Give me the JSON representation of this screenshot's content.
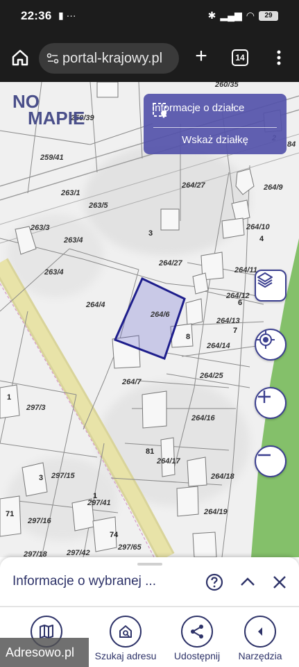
{
  "status_bar": {
    "time": "22:36",
    "left_icons": "▮ ···",
    "battery": "29"
  },
  "browser": {
    "url": "portal-krajowy.pl",
    "tab_count": "14"
  },
  "map": {
    "logo_line1": "NO",
    "logo_line2": "MAPIE",
    "info_panel": {
      "title": "Informacje o działce",
      "show_parcel": "Wskaż działkę"
    },
    "parcel_labels": [
      "260/35",
      "259/39",
      "259/41",
      "264/27",
      "264/9",
      "263/1",
      "263/5",
      "264/10",
      "263/3",
      "263/4",
      "264/27",
      "264/11",
      "263/4",
      "264/4",
      "264/12",
      "264/6",
      "264/13",
      "264/14",
      "264/25",
      "264/7",
      "297/3",
      "264/16",
      "264/17",
      "264/18",
      "297/15",
      "297/41",
      "297/16",
      "264/19",
      "297/65",
      "297/42",
      "297/18",
      "2",
      "84"
    ],
    "house_numbers": [
      "3",
      "4",
      "6",
      "7",
      "8",
      "1",
      "81",
      "3",
      "1",
      "71",
      "74"
    ],
    "selected_parcel": "264/6"
  },
  "sheet": {
    "title": "Informacje o wybranej ...",
    "nav": [
      {
        "label": ""
      },
      {
        "label": "Szukaj adresu"
      },
      {
        "label": "Udostępnij"
      },
      {
        "label": "Narzędzia"
      }
    ]
  },
  "watermark": "Adresowo.pl"
}
